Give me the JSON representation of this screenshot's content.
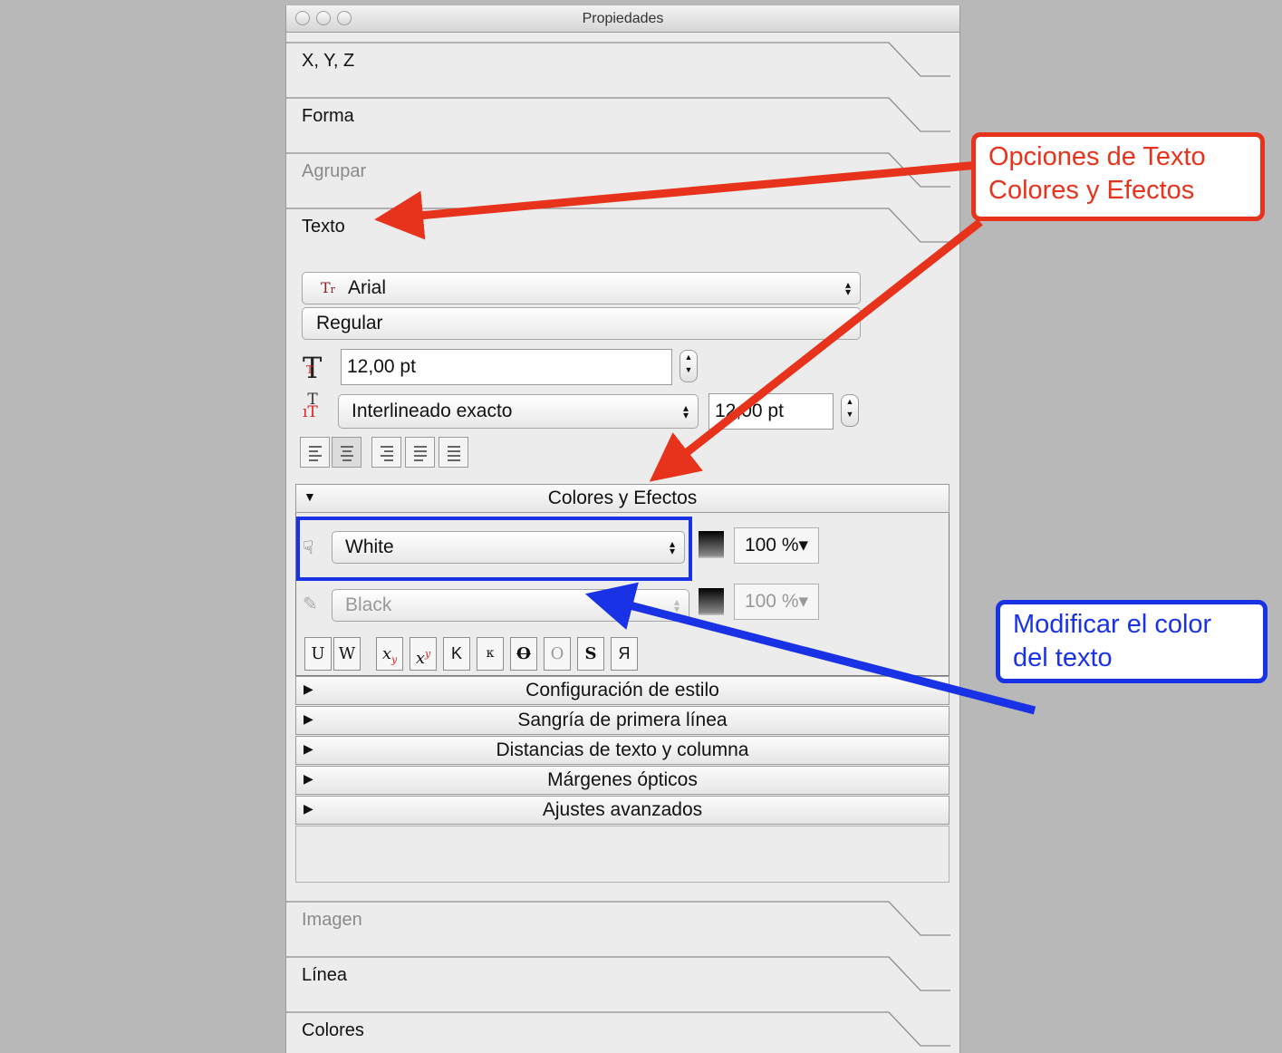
{
  "window": {
    "title": "Propiedades"
  },
  "tabs": {
    "xyz": "X, Y, Z",
    "forma": "Forma",
    "agrupar": "Agrupar",
    "texto": "Texto",
    "imagen": "Imagen",
    "linea": "Línea",
    "colores": "Colores"
  },
  "text_panel": {
    "font_family": "Arial",
    "font_style": "Regular",
    "font_size": "12,00 pt",
    "line_spacing_mode": "Interlineado exacto",
    "line_spacing_value": "12,00 pt"
  },
  "sections": {
    "colores_efectos": "Colores y Efectos",
    "configuracion_estilo": "Configuración de estilo",
    "sangria": "Sangría de primera línea",
    "distancias": "Distancias de texto y columna",
    "margenes": "Márgenes ópticos",
    "ajustes": "Ajustes avanzados"
  },
  "colors": {
    "fill_color": "White",
    "fill_opacity": "100 %",
    "stroke_color": "Black",
    "stroke_opacity": "100 %"
  },
  "format_buttons": [
    "U",
    "W",
    "x",
    "x",
    "K",
    "κ",
    "O",
    "O",
    "S",
    "Я"
  ],
  "annotations": {
    "callout_red": "Opciones de Texto\nColores y Efectos",
    "callout_blue": "Modificar el color\ndel texto",
    "red_color": "#e8331c",
    "blue_color": "#1a32e6"
  }
}
